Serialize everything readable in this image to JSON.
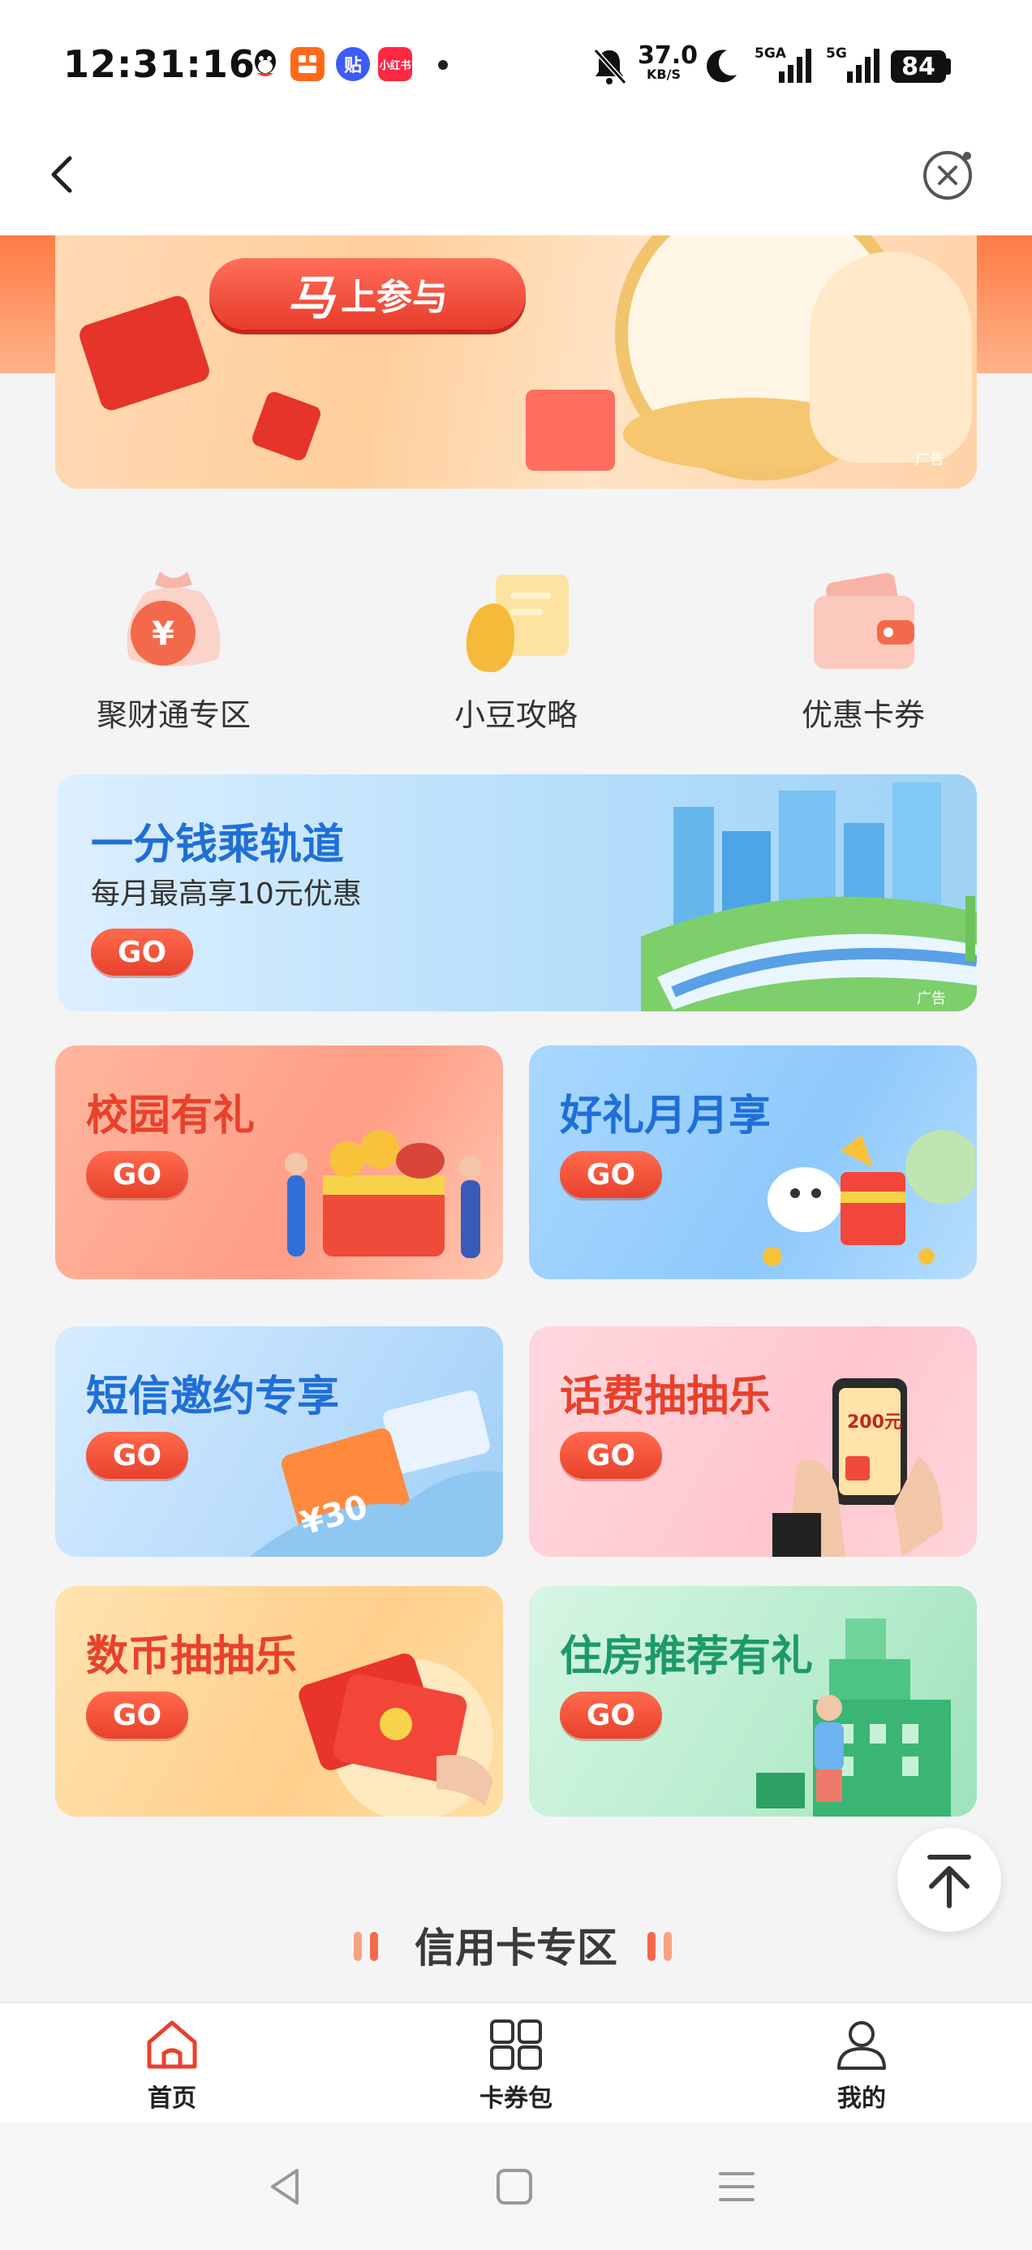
{
  "status_bar": {
    "time": "12:31:16",
    "apps": [
      {
        "name": "qq-icon",
        "label": "",
        "color": "#111111"
      },
      {
        "name": "app-orange-icon",
        "label": "",
        "color": "#ff6a1a"
      },
      {
        "name": "tieba-icon",
        "label": "贴",
        "color": "#3d5bf5"
      },
      {
        "name": "xiaohongshu-icon",
        "label": "小红书",
        "color": "#ff2742"
      }
    ],
    "net_speed": "37.0",
    "net_unit": "KB/S",
    "signal1": "5GA",
    "signal2": "5G",
    "battery": "84"
  },
  "top_banner": {
    "pill_text": "上参与",
    "pill_prefix": "马",
    "ad_text": "广告"
  },
  "quick_links": [
    {
      "label": "聚财通专区",
      "icon": "money-bag-icon"
    },
    {
      "label": "小豆攻略",
      "icon": "guide-book-icon"
    },
    {
      "label": "优惠卡券",
      "icon": "wallet-icon"
    }
  ],
  "rail_banner": {
    "title": "一分钱乘轨道",
    "subtitle": "每月最高享10元优惠",
    "go": "GO",
    "ad_text": "广告"
  },
  "cards": [
    {
      "title": "校园有礼",
      "go": "GO"
    },
    {
      "title": "好礼月月享",
      "go": "GO"
    },
    {
      "title": "短信邀约专享",
      "go": "GO",
      "coupon_text": "¥30"
    },
    {
      "title": "话费抽抽乐",
      "go": "GO",
      "phone_text": "200元"
    },
    {
      "title": "数币抽抽乐",
      "go": "GO"
    },
    {
      "title": "住房推荐有礼",
      "go": "GO"
    }
  ],
  "section_title": "信用卡专区",
  "tabs": [
    {
      "label": "首页",
      "icon": "home-icon",
      "active": true
    },
    {
      "label": "卡券包",
      "icon": "card-wallet-icon",
      "active": false
    },
    {
      "label": "我的",
      "icon": "profile-icon",
      "active": false
    }
  ],
  "colors": {
    "accent": "#e8412c",
    "blue_title": "#1f6fd6",
    "red_title": "#e8412c",
    "green_title": "#1d9a66"
  }
}
